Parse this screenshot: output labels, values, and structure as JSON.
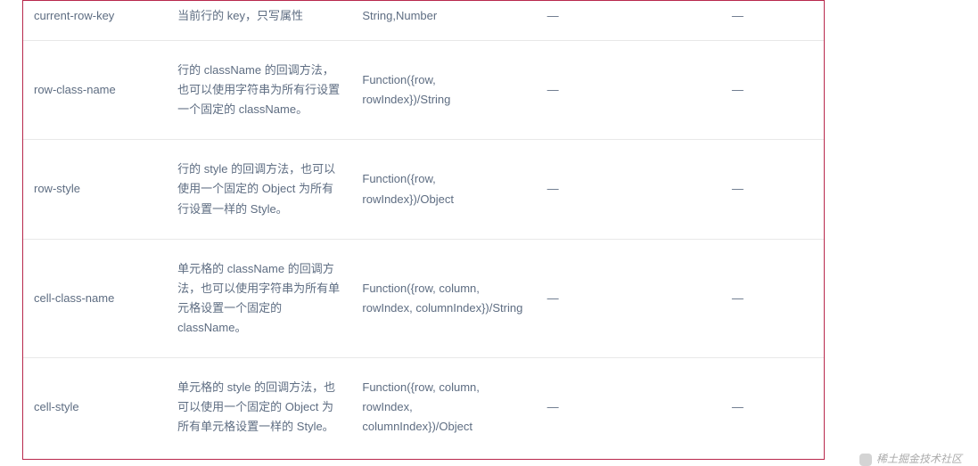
{
  "table": {
    "rows": [
      {
        "name": "current-row-key",
        "desc": "当前行的 key，只写属性",
        "type": "String,Number",
        "options": "—",
        "default": "—"
      },
      {
        "name": "row-class-name",
        "desc": "行的 className 的回调方法，也可以使用字符串为所有行设置一个固定的 className。",
        "type": "Function({row, rowIndex})/String",
        "options": "—",
        "default": "—"
      },
      {
        "name": "row-style",
        "desc": "行的 style 的回调方法，也可以使用一个固定的 Object 为所有行设置一样的 Style。",
        "type": "Function({row, rowIndex})/Object",
        "options": "—",
        "default": "—"
      },
      {
        "name": "cell-class-name",
        "desc": "单元格的 className 的回调方法，也可以使用字符串为所有单元格设置一个固定的 className。",
        "type": "Function({row, column, rowIndex, columnIndex})/String",
        "options": "—",
        "default": "—"
      },
      {
        "name": "cell-style",
        "desc": "单元格的 style 的回调方法，也可以使用一个固定的 Object 为所有单元格设置一样的 Style。",
        "type": "Function({row, column, rowIndex, columnIndex})/Object",
        "options": "—",
        "default": "—"
      }
    ]
  },
  "watermark": "稀土掘金技术社区"
}
